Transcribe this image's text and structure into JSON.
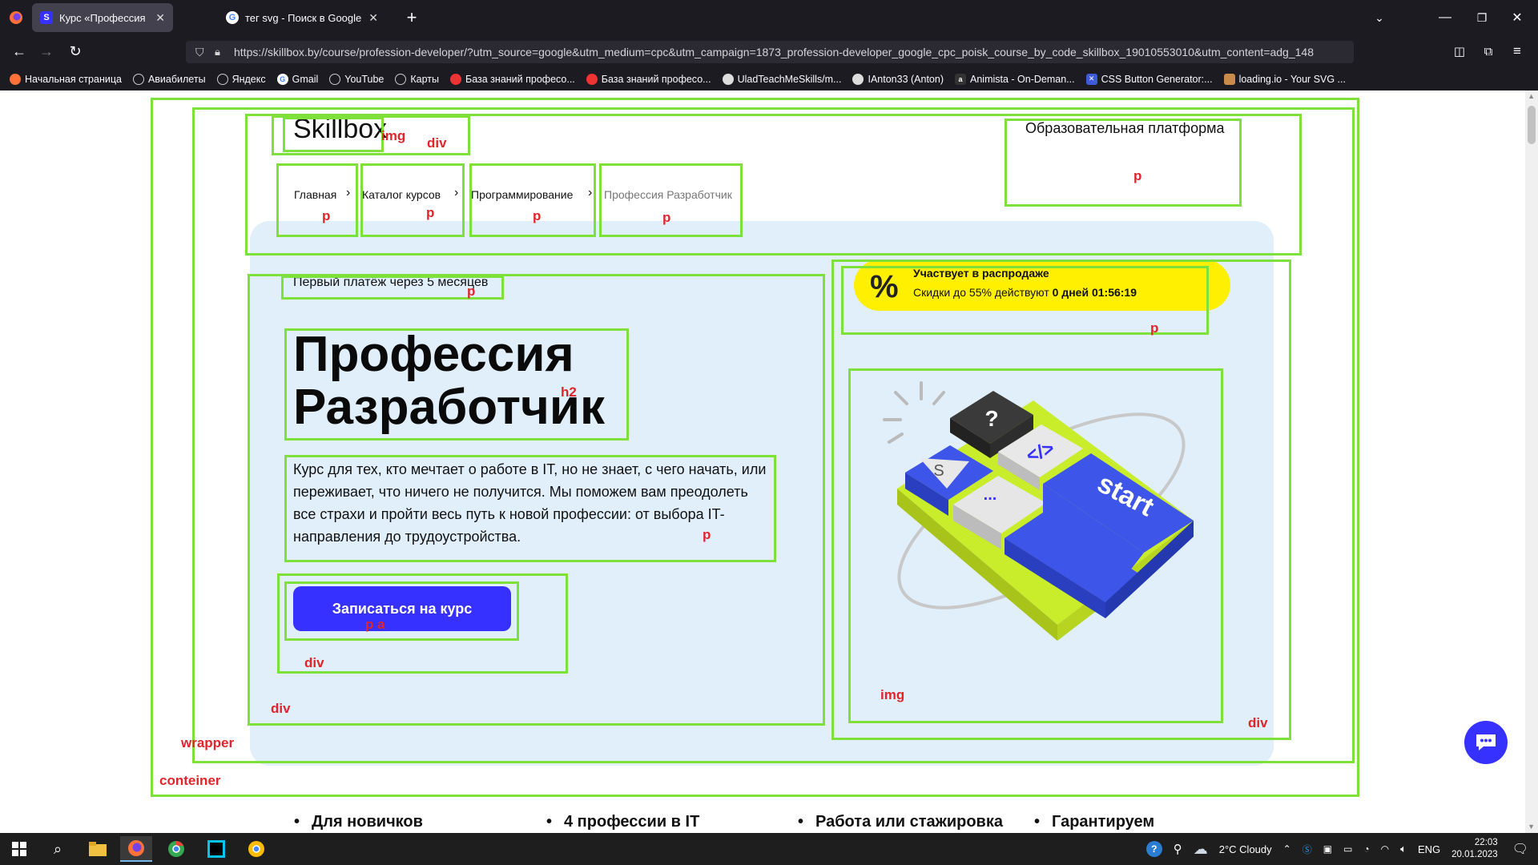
{
  "browser": {
    "tabs": [
      {
        "title": "Курс «Профессия Разработчи",
        "favicon_letter": "S",
        "favicon_color": "#3631ff",
        "active": true
      },
      {
        "title": "тег svg - Поиск в Google",
        "favicon_letter": "G",
        "favicon_color": "#ffffff",
        "active": false
      }
    ],
    "new_tab_label": "+",
    "url": "https://skillbox.by/course/profession-developer/?utm_source=google&utm_medium=cpc&utm_campaign=1873_profession-developer_google_cpc_poisk_course_by_code_skillbox_19010553010&utm_content=adg_148",
    "bookmarks": [
      {
        "label": "Начальная страница",
        "icon": "firefox-icon"
      },
      {
        "label": "Авиабилеты",
        "icon": "globe-icon"
      },
      {
        "label": "Яндекс",
        "icon": "globe-icon"
      },
      {
        "label": "Gmail",
        "icon": "google-icon"
      },
      {
        "label": "YouTube",
        "icon": "globe-icon"
      },
      {
        "label": "Карты",
        "icon": "globe-icon"
      },
      {
        "label": "База знаний професо...",
        "icon": "opera-icon"
      },
      {
        "label": "База знаний професо...",
        "icon": "opera-icon"
      },
      {
        "label": "UladTeachMeSkills/m...",
        "icon": "github-icon"
      },
      {
        "label": "IAnton33 (Anton)",
        "icon": "github-icon"
      },
      {
        "label": "Animista - On-Deman...",
        "icon": "animista-icon"
      },
      {
        "label": "CSS Button Generator:...",
        "icon": "css-icon"
      },
      {
        "label": "loading.io - Your SVG ...",
        "icon": "loading-icon"
      }
    ]
  },
  "page": {
    "logo": "Skillbox",
    "platform_label": "Образовательная платформа",
    "breadcrumbs": [
      "Главная",
      "Каталог курсов",
      "Программирование",
      "Профессия Разработчик"
    ],
    "first_payment": "Первый платёж через 5 месяцев",
    "title_line1": "Профессия",
    "title_line2": "Разработчик",
    "description": "Курс для тех, кто мечтает о работе в IT, но не знает, с чего начать, или переживает, что ничего не получится. Мы поможем вам преодолеть все страхи и пройти весь путь к новой профессии: от выбора IT-направления до трудоустройства.",
    "cta_label": "Записаться на курс",
    "sale": {
      "percent_symbol": "%",
      "title": "Участвует в распродаже",
      "text_prefix": "Скидки до 55% действуют ",
      "days": "0 дней",
      "timer": "01:56:19"
    },
    "illustration_keys": [
      "?",
      "</>",
      "S",
      "...",
      "start"
    ],
    "features": [
      "Для новичков",
      "4 профессии в IT",
      "Работа или стажировка",
      "Гарантируем"
    ]
  },
  "annotations": {
    "tags": [
      "img",
      "div",
      "p",
      "p",
      "p",
      "p",
      "p",
      "p",
      "p",
      "h2",
      "p",
      "p a",
      "div",
      "div",
      "img",
      "div",
      "wrapper",
      "conteiner"
    ]
  },
  "taskbar": {
    "weather": "2°C  Cloudy",
    "lang": "ENG",
    "time": "22:03",
    "date": "20.01.2023"
  },
  "colors": {
    "brand_blue": "#3631ff",
    "hero_bg": "#e1effb",
    "sale_yellow": "#ffef00",
    "annotation_green": "#7ee03a",
    "annotation_red": "#e0252b"
  }
}
